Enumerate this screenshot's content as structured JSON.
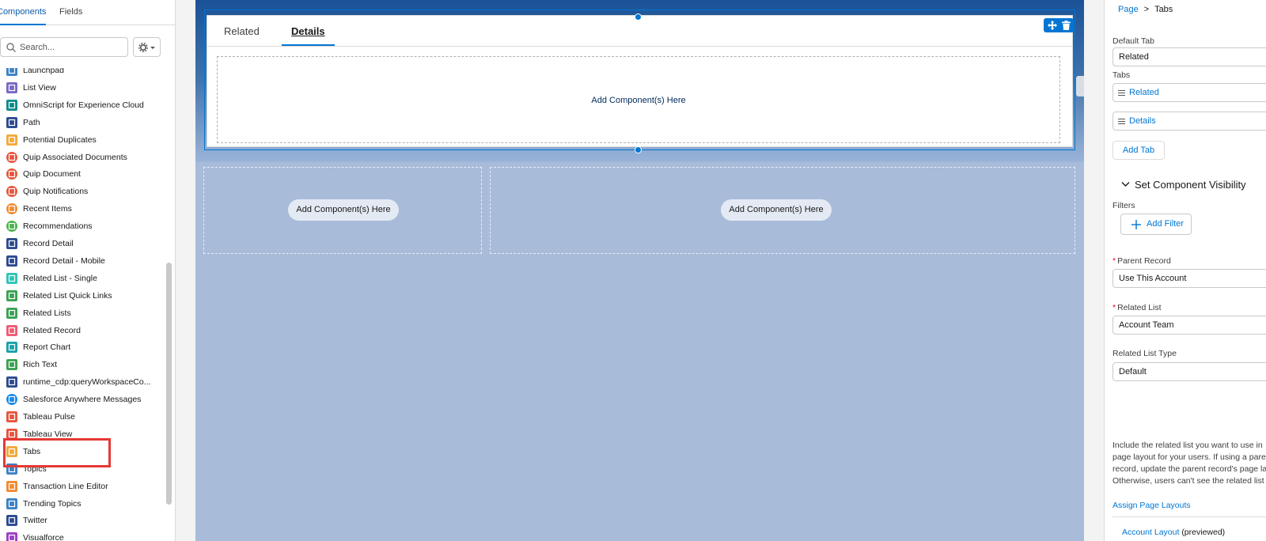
{
  "left_panel": {
    "tabs": [
      "Components",
      "Fields"
    ],
    "search_placeholder": "Search...",
    "components": [
      {
        "label": "Launchpad",
        "color": "#3b82c4"
      },
      {
        "label": "List View",
        "color": "#7b68c5"
      },
      {
        "label": "OmniScript for Experience Cloud",
        "color": "#0b8a8a"
      },
      {
        "label": "Path",
        "color": "#2c4b8f"
      },
      {
        "label": "Potential Duplicates",
        "color": "#f2a93b"
      },
      {
        "label": "Quip Associated Documents",
        "color": "#e8553d"
      },
      {
        "label": "Quip Document",
        "color": "#e8553d"
      },
      {
        "label": "Quip Notifications",
        "color": "#e8553d"
      },
      {
        "label": "Recent Items",
        "color": "#f28b30"
      },
      {
        "label": "Recommendations",
        "color": "#4bb34b"
      },
      {
        "label": "Record Detail",
        "color": "#2c4b8f"
      },
      {
        "label": "Record Detail - Mobile",
        "color": "#2c4b8f"
      },
      {
        "label": "Related List - Single",
        "color": "#2ec4b6"
      },
      {
        "label": "Related List Quick Links",
        "color": "#3aa152"
      },
      {
        "label": "Related Lists",
        "color": "#3aa152"
      },
      {
        "label": "Related Record",
        "color": "#ef5a74"
      },
      {
        "label": "Report Chart",
        "color": "#1aa0a8"
      },
      {
        "label": "Rich Text",
        "color": "#3aa152"
      },
      {
        "label": "runtime_cdp:queryWorkspaceCo...",
        "color": "#2c4b8f"
      },
      {
        "label": "Salesforce Anywhere Messages",
        "color": "#1589ee"
      },
      {
        "label": "Tableau Pulse",
        "color": "#e8553d"
      },
      {
        "label": "Tableau View",
        "color": "#e8553d"
      },
      {
        "label": "Tabs",
        "color": "#f2a93b"
      },
      {
        "label": "Topics",
        "color": "#3b82c4"
      },
      {
        "label": "Transaction Line Editor",
        "color": "#f28b30"
      },
      {
        "label": "Trending Topics",
        "color": "#3b82c4"
      },
      {
        "label": "Twitter",
        "color": "#2c4b8f"
      },
      {
        "label": "Visualforce",
        "color": "#9c3fc4"
      }
    ]
  },
  "canvas": {
    "tabs": [
      "Related",
      "Details"
    ],
    "active_tab": "Details",
    "drop_label": "Add Component(s) Here",
    "region_left_label": "Add Component(s) Here",
    "region_right_label": "Add Component(s) Here"
  },
  "right_panel": {
    "breadcrumb_root": "Page",
    "breadcrumb_sep": ">",
    "breadcrumb_current": "Tabs",
    "default_tab_label": "Default Tab",
    "default_tab_value": "Related",
    "tabs_label": "Tabs",
    "tab_items": [
      "Related",
      "Details"
    ],
    "add_tab": "Add Tab",
    "visibility_title": "Set Component Visibility",
    "filters_label": "Filters",
    "add_filter": "Add Filter",
    "parent_record_label": "Parent Record",
    "parent_record_value": "Use This Account",
    "related_list_label": "Related List",
    "related_list_value": "Account Team",
    "related_list_type_label": "Related List Type",
    "related_list_type_value": "Default",
    "help_lines": [
      "Include the related list you want to use in",
      "page layout for your users. If using a pare",
      "record, update the parent record's page la",
      "Otherwise, users can't see the related list"
    ],
    "assign_link": "Assign Page Layouts",
    "layout_link": "Account Layout",
    "layout_suffix": "(previewed)"
  },
  "colors": {
    "brand_blue": "#0176d3",
    "highlight_red": "#e53935",
    "canvas_bg": "#a8bbd9"
  }
}
